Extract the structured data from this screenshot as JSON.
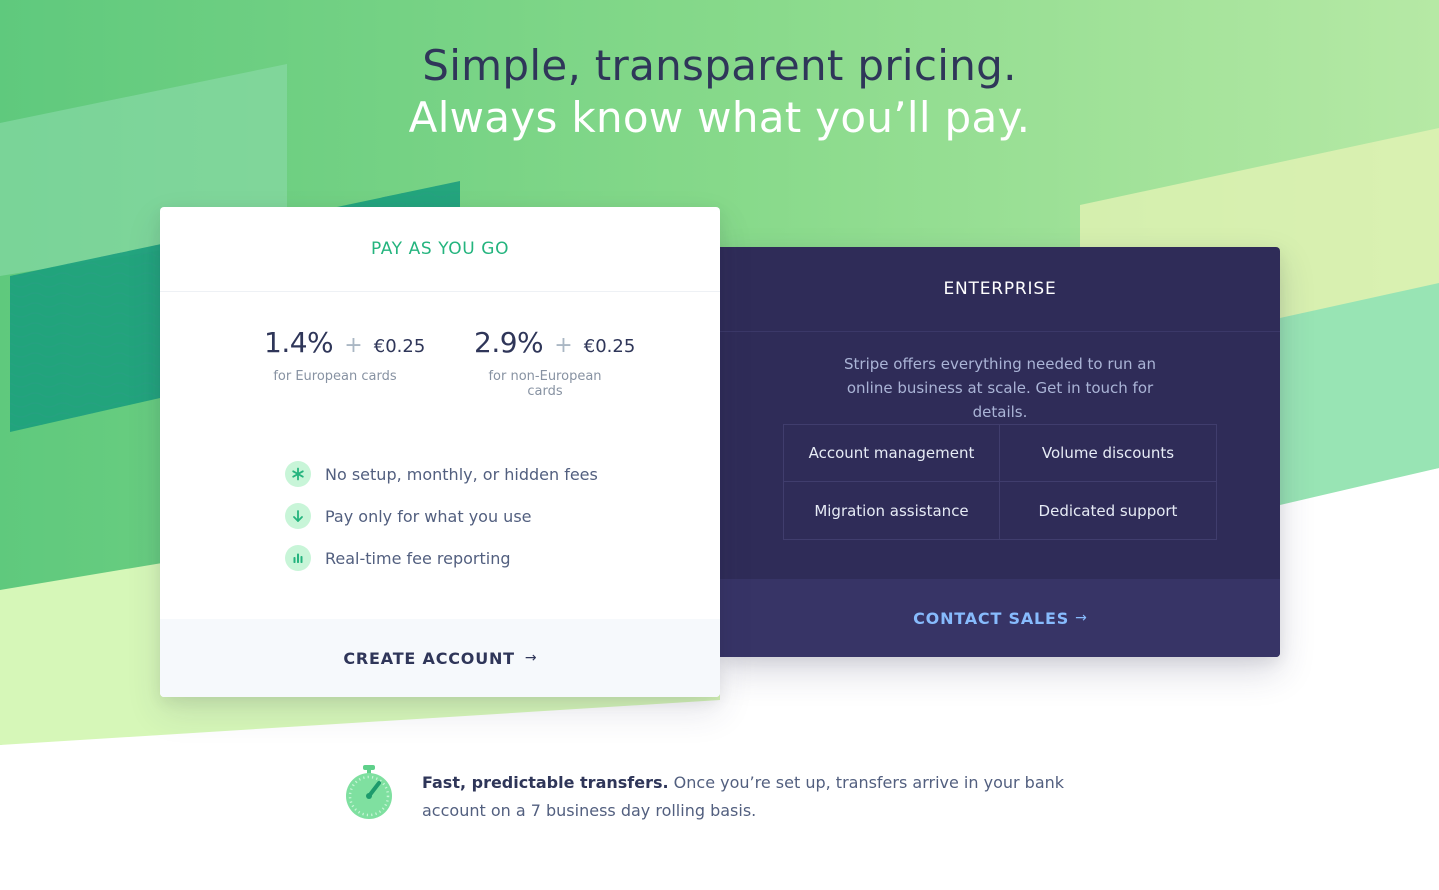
{
  "hero": {
    "line1": "Simple, transparent pricing.",
    "line2": "Always know what you’ll pay."
  },
  "payg": {
    "title": "PAY AS YOU GO",
    "rates": [
      {
        "percent": "1.4%",
        "plus": "+",
        "fee": "€0.25",
        "note": "for European cards"
      },
      {
        "percent": "2.9%",
        "plus": "+",
        "fee": "€0.25",
        "note": "for non-European cards"
      }
    ],
    "features": [
      {
        "icon": "asterisk-icon",
        "label": "No setup, monthly, or hidden fees"
      },
      {
        "icon": "arrow-down-icon",
        "label": "Pay only for what you use"
      },
      {
        "icon": "bar-chart-icon",
        "label": "Real-time fee reporting"
      }
    ],
    "cta": {
      "label": "CREATE ACCOUNT",
      "arrow": "→"
    }
  },
  "enterprise": {
    "title": "ENTERPRISE",
    "description": "Stripe offers everything needed to run an online business at scale. Get in touch for details.",
    "items": [
      "Account management",
      "Volume discounts",
      "Migration assistance",
      "Dedicated support"
    ],
    "cta": {
      "label": "CONTACT SALES",
      "arrow": "→"
    }
  },
  "transfers": {
    "icon": "stopwatch-icon",
    "strong": "Fast, predictable transfers.",
    "text": " Once you’re set up, transfers arrive in your bank account on a 7 business day rolling basis."
  },
  "colors": {
    "accent_green": "#24b47e",
    "heading_navy": "#2f3659",
    "enterprise_bg": "#2f2c58",
    "contact_link": "#87bbfd"
  }
}
